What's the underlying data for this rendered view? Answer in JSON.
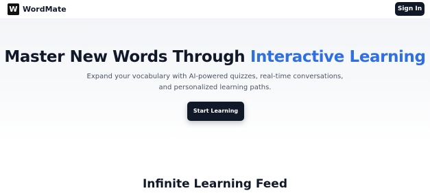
{
  "header": {
    "logo_letter": "W",
    "brand_name": "WordMate",
    "signin_label": "Sign In"
  },
  "hero": {
    "title_main": "Master New Words Through ",
    "title_accent": "Interactive Learning",
    "subtitle_line1": "Expand your vocabulary with AI-powered quizzes, real-time conversations,",
    "subtitle_line2": "and personalized learning paths.",
    "cta_label": "Start Learning"
  },
  "feed": {
    "title": "Infinite Learning Feed"
  },
  "colors": {
    "accent": "#2f6fdf",
    "dark": "#111827"
  }
}
